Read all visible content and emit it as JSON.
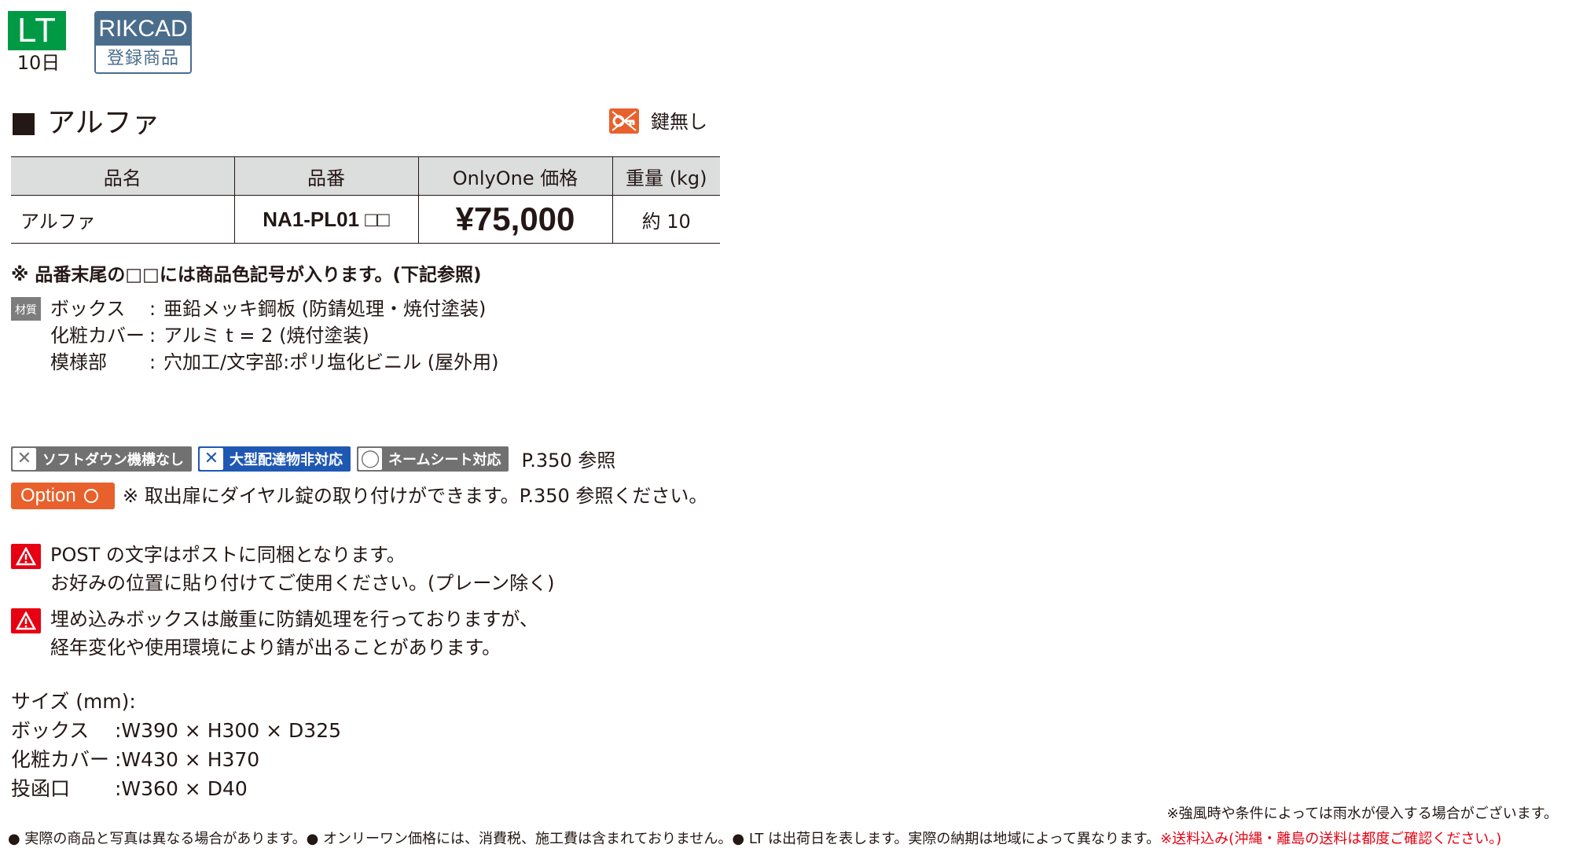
{
  "badges": {
    "lt_label": "LT",
    "lt_days": "10日",
    "rikcad_label": "RIKCAD",
    "rikcad_sub": "登録商品"
  },
  "product": {
    "title": "アルファ",
    "lock_label": "鍵無し"
  },
  "table": {
    "headers": [
      "品名",
      "品番",
      "OnlyOne 価格",
      "重量 (kg)"
    ],
    "rows": [
      {
        "name": "アルファ",
        "code": "NA1-PL01 □□",
        "price": "¥75,000",
        "weight": "約 10"
      }
    ]
  },
  "code_note": "※ 品番末尾の□□には商品色記号が入ります。(下記参照)",
  "material": {
    "icon_label": "材質",
    "rows": [
      {
        "key": "ボックス",
        "value": "亜鉛メッキ鋼板 (防錆処理・焼付塗装)"
      },
      {
        "key": "化粧カバー",
        "value": "アルミ t = 2 (焼付塗装)"
      },
      {
        "key": "模様部",
        "value": "穴加工/文字部:ポリ塩化ビニル (屋外用)"
      }
    ]
  },
  "chips": [
    {
      "mark": "✕",
      "label": "ソフトダウン機構なし",
      "color": "#727171"
    },
    {
      "mark": "✕",
      "label": "大型配達物非対応",
      "color": "#1e58b3"
    },
    {
      "mark": "◯",
      "label": "ネームシート対応",
      "color": "#727171"
    }
  ],
  "chips_ref": "P.350 参照",
  "option": {
    "badge": "Option",
    "text": "※ 取出扉にダイヤル錠の取り付けができます。P.350 参照ください。"
  },
  "warnings": [
    {
      "lines": [
        "POST の文字はポストに同梱となります。",
        "お好みの位置に貼り付けてご使用ください。(プレーン除く)"
      ]
    },
    {
      "lines": [
        "埋め込みボックスは厳重に防錆処理を行っておりますが、",
        "経年変化や使用環境により錆が出ることがあります。"
      ]
    }
  ],
  "size": {
    "heading": "サイズ (mm):",
    "rows": [
      {
        "key": "ボックス",
        "value": ":W390 × H300 × D325"
      },
      {
        "key": "化粧カバー",
        "value": ":W430 × H370"
      },
      {
        "key": "投函口",
        "value": ":W360 × D40"
      }
    ]
  },
  "footer": {
    "right_note": "※強風時や条件によっては雨水が侵入する場合がございます。",
    "bottom_note": "● 実際の商品と写真は異なる場合があります。● オンリーワン価格には、消費税、施工費は含まれておりません。● LT は出荷日を表します。実際の納期は地域によって異なります。",
    "shipping_note": "※送料込み(沖縄・離島の送料は都度ご確認ください。)"
  },
  "colors": {
    "lt_green": "#009944",
    "rikcad_blue": "#4a6d8c",
    "accent_orange": "#e8612c",
    "warning_red": "#e60012",
    "table_header_gray": "#dcdddd"
  }
}
